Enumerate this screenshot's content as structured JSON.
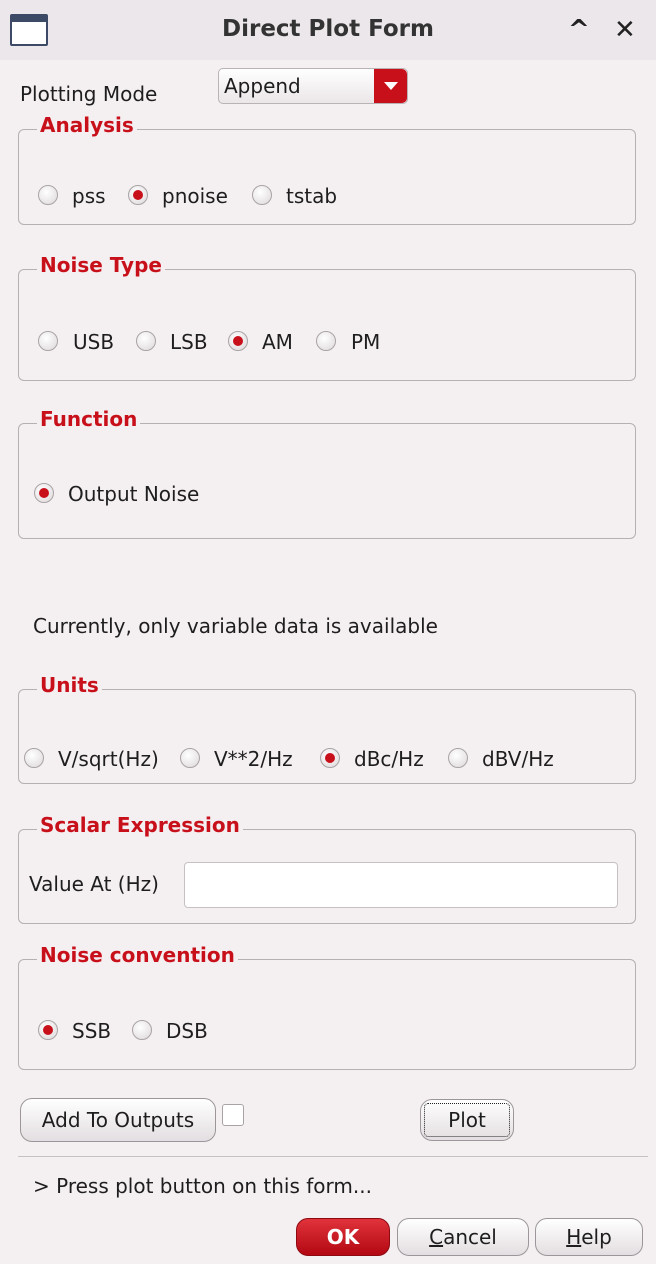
{
  "window": {
    "title": "Direct Plot Form",
    "minimize_glyph": "^",
    "close_glyph": "✕"
  },
  "plotting_mode": {
    "label": "Plotting Mode",
    "value": "Append"
  },
  "analysis": {
    "title": "Analysis",
    "options": [
      "pss",
      "pnoise",
      "tstab"
    ],
    "selected": "pnoise"
  },
  "noise_type": {
    "title": "Noise Type",
    "options": [
      "USB",
      "LSB",
      "AM",
      "PM"
    ],
    "selected": "AM"
  },
  "function": {
    "title": "Function",
    "options": [
      "Output Noise"
    ],
    "selected": "Output Noise"
  },
  "info_text": "Currently, only variable data is available",
  "units": {
    "title": "Units",
    "options": [
      "V/sqrt(Hz)",
      "V**2/Hz",
      "dBc/Hz",
      "dBV/Hz"
    ],
    "selected": "dBc/Hz"
  },
  "scalar_expression": {
    "title": "Scalar Expression",
    "value_label": "Value At (Hz)",
    "value": ""
  },
  "noise_convention": {
    "title": "Noise convention",
    "options": [
      "SSB",
      "DSB"
    ],
    "selected": "SSB"
  },
  "buttons": {
    "add_to_outputs": "Add To Outputs",
    "plot": "Plot",
    "ok": "OK",
    "cancel_rest": "ancel",
    "cancel_first": "C",
    "help_first": "H",
    "help_rest": "elp"
  },
  "add_to_outputs_checked": false,
  "status_text": "> Press plot button on this form..."
}
